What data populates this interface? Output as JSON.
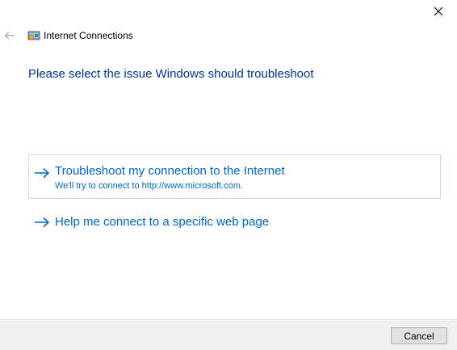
{
  "window": {
    "title": "Internet Connections",
    "close_icon": "close-icon",
    "back_icon": "back-arrow-icon",
    "app_icon": "internet-connections-icon"
  },
  "main": {
    "heading": "Please select the issue Windows should troubleshoot",
    "options": [
      {
        "title": "Troubleshoot my connection to the Internet",
        "description": "We'll try to connect to http://www.microsoft.com.",
        "icon": "arrow-right-icon",
        "selected": true
      },
      {
        "title": "Help me connect to a specific web page",
        "icon": "arrow-right-icon",
        "selected": false
      }
    ]
  },
  "footer": {
    "cancel_label": "Cancel"
  },
  "colors": {
    "heading": "#003399",
    "link": "#0066cc",
    "selected_border": "#c5dbee",
    "footer_bg": "#f0f0f0"
  }
}
